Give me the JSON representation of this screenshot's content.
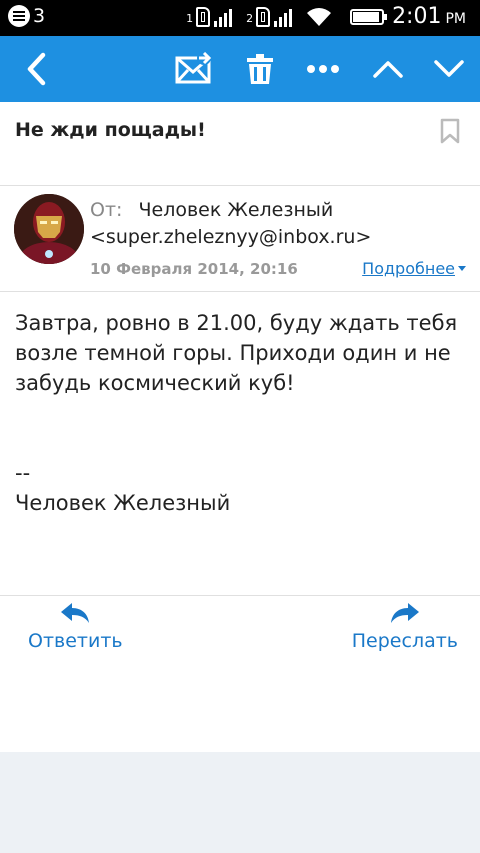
{
  "status_bar": {
    "notification_count": "3",
    "sim1_label": "1",
    "sim2_label": "2",
    "battery_level": 0.85,
    "time": "2:01",
    "ampm": "PM"
  },
  "toolbar": {
    "icons": [
      "back-icon",
      "mark-unread-icon",
      "trash-icon",
      "more-icon",
      "previous-icon",
      "next-icon"
    ],
    "color": "#1e90e1"
  },
  "message": {
    "subject": "Не жди пощады!",
    "from_label": "От:",
    "sender_name": "Человек Железный",
    "sender_email": "<super.zheleznyy@inbox.ru>",
    "date": "10 Февраля 2014, 20:16",
    "details_link": "Подробнее",
    "body": "Завтра, ровно в 21.00, буду ждать тебя возле темной горы. Приходи один и не забудь космический куб!",
    "signature_separator": "--",
    "signature_name": "Человек Железный"
  },
  "actions": {
    "reply_label": "Ответить",
    "forward_label": "Переслать",
    "accent": "#1a78c8"
  }
}
